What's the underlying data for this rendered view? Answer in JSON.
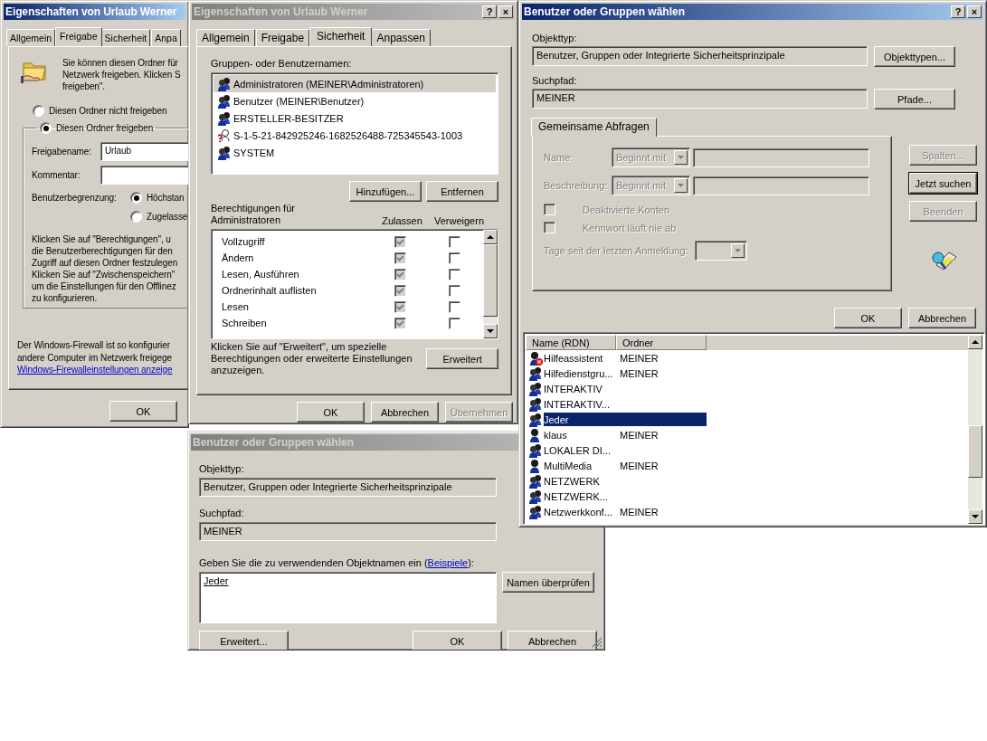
{
  "sharing_dialog": {
    "title": "Eigenschaften von Urlaub Werner",
    "active": true,
    "tabs": [
      {
        "label": "Allgemein",
        "selected": false
      },
      {
        "label": "Freigabe",
        "selected": true
      },
      {
        "label": "Sicherheit",
        "selected": false
      },
      {
        "label": "Anpa",
        "selected": false
      }
    ],
    "intro_lines": [
      "Sie können diesen Ordner für",
      "Netzwerk freigeben. Klicken S",
      "freigeben\"."
    ],
    "share_options": [
      {
        "label": "Diesen Ordner nicht freigeben",
        "selected": false
      },
      {
        "label": "Diesen Ordner freigeben",
        "selected": true
      }
    ],
    "share_name_label": "Freigabename:",
    "share_name": "Urlaub",
    "comment_label": "Kommentar:",
    "user_limit_label": "Benutzerbegrenzung:",
    "user_limit_options": [
      {
        "label": "Höchstan",
        "selected": true
      },
      {
        "label": "Zugelasse",
        "selected": false
      }
    ],
    "permissions_note_lines": [
      "Klicken Sie auf \"Berechtigungen\", u",
      "die Benutzerberechtigungen für den",
      "Zugriff auf diesen Ordner festzulegen",
      "Klicken Sie auf \"Zwischenspeichern\"",
      "um die Einstellungen für den Offlinez",
      "zu konfigurieren."
    ],
    "firewall_note_lines": [
      "Der Windows-Firewall ist so konfigurier",
      "andere Computer im Netzwerk freigege"
    ],
    "firewall_link": "Windows-Firewalleinstellungen anzeige",
    "buttons": [
      "OK"
    ]
  },
  "security_dialog": {
    "title": "Eigenschaften von Urlaub Werner",
    "active": false,
    "title_buttons": [
      "?",
      "×"
    ],
    "tabs": [
      {
        "label": "Allgemein",
        "selected": false
      },
      {
        "label": "Freigabe",
        "selected": false
      },
      {
        "label": "Sicherheit",
        "selected": true
      },
      {
        "label": "Anpassen",
        "selected": false
      }
    ],
    "groups_label": "Gruppen- oder Benutzernamen:",
    "groups": [
      {
        "name": "Administratoren (MEINER\\Administratoren)",
        "kind": "group",
        "selected": true
      },
      {
        "name": "Benutzer (MEINER\\Benutzer)",
        "kind": "group",
        "selected": false
      },
      {
        "name": "ERSTELLER-BESITZER",
        "kind": "group",
        "selected": false
      },
      {
        "name": "S-1-5-21-842925246-1682526488-725345543-1003",
        "kind": "unknown",
        "selected": false
      },
      {
        "name": "SYSTEM",
        "kind": "group",
        "selected": false
      }
    ],
    "add_button": "Hinzufügen...",
    "remove_button": "Entfernen",
    "permissions_label_lines": [
      "Berechtigungen für",
      "Administratoren"
    ],
    "allow_heading": "Zulassen",
    "deny_heading": "Verweigern",
    "permissions": [
      {
        "name": "Vollzugriff",
        "allow": true,
        "deny": false,
        "inherited": true
      },
      {
        "name": "Ändern",
        "allow": true,
        "deny": false,
        "inherited": true
      },
      {
        "name": "Lesen, Ausführen",
        "allow": true,
        "deny": false,
        "inherited": true
      },
      {
        "name": "Ordnerinhalt auflisten",
        "allow": true,
        "deny": false,
        "inherited": true
      },
      {
        "name": "Lesen",
        "allow": true,
        "deny": false,
        "inherited": true
      },
      {
        "name": "Schreiben",
        "allow": true,
        "deny": false,
        "inherited": true
      }
    ],
    "advanced_note": "Klicken Sie auf \"Erweitert\", um spezielle Berechtigungen oder erweiterte Einstellungen anzuzeigen.",
    "advanced_button": "Erweitert",
    "buttons": [
      {
        "label": "OK",
        "disabled": false
      },
      {
        "label": "Abbrechen",
        "disabled": false
      },
      {
        "label": "Übernehmen",
        "disabled": true
      }
    ]
  },
  "select_dialog": {
    "title": "Benutzer oder Gruppen wählen",
    "active": true,
    "title_buttons": [
      "?",
      "×"
    ],
    "object_type_label": "Objekttyp:",
    "object_type": "Benutzer, Gruppen oder Integrierte Sicherheitsprinzipale",
    "object_types_button": "Objekttypen...",
    "search_path_label": "Suchpfad:",
    "search_path": "MEINER",
    "paths_button": "Pfade...",
    "query_tab": "Gemeinsame Abfragen",
    "query_disabled": true,
    "name_label": "Name:",
    "name_match": "Beginnt mit",
    "description_label": "Beschreibung:",
    "description_match": "Beginnt mit",
    "query_checkboxes": [
      {
        "label": "Deaktivierte Konten",
        "checked": false
      },
      {
        "label": "Kennwort läuft nie ab",
        "checked": false
      }
    ],
    "days_label": "Tage seit der letzten Anmeldung:",
    "side_buttons": [
      {
        "label": "Spalten...",
        "disabled": true
      },
      {
        "label": "Jetzt suchen",
        "disabled": false
      },
      {
        "label": "Beenden",
        "disabled": true
      }
    ],
    "buttons": [
      "OK",
      "Abbrechen"
    ],
    "results": {
      "columns": [
        "Name (RDN)",
        "Ordner"
      ],
      "rows": [
        {
          "name": "Hilfeassistent",
          "folder": "MEINER",
          "kind": "disabled-user",
          "selected": false
        },
        {
          "name": "Hilfedienstgru...",
          "folder": "MEINER",
          "kind": "group",
          "selected": false
        },
        {
          "name": "INTERAKTIV",
          "kind": "group",
          "selected": false
        },
        {
          "name": "INTERAKTIV...",
          "kind": "group",
          "selected": false
        },
        {
          "name": "Jeder",
          "kind": "group",
          "selected": true
        },
        {
          "name": "klaus",
          "folder": "MEINER",
          "kind": "user",
          "selected": false
        },
        {
          "name": "LOKALER DI...",
          "kind": "group",
          "selected": false
        },
        {
          "name": "MultiMedia",
          "folder": "MEINER",
          "kind": "user",
          "selected": false
        },
        {
          "name": "NETZWERK",
          "kind": "group",
          "selected": false
        },
        {
          "name": "NETZWERK...",
          "kind": "group",
          "selected": false
        },
        {
          "name": "Netzwerkkonf...",
          "folder": "MEINER",
          "kind": "group",
          "selected": false
        }
      ]
    }
  },
  "names_dialog": {
    "title": "Benutzer oder Gruppen wählen",
    "active": false,
    "object_type_label": "Objekttyp:",
    "object_type": "Benutzer, Gruppen oder Integrierte Sicherheitsprinzipale",
    "search_path_label": "Suchpfad:",
    "search_path": "MEINER",
    "names_prompt": "Geben Sie die zu verwendenden Objektnamen ein (",
    "names_link": "Beispiele",
    "names_prompt_end": "):",
    "entered_name": "Jeder",
    "check_names_button": "Namen überprüfen",
    "advanced_button": "Erweitert...",
    "buttons": [
      "OK",
      "Abbrechen"
    ]
  }
}
